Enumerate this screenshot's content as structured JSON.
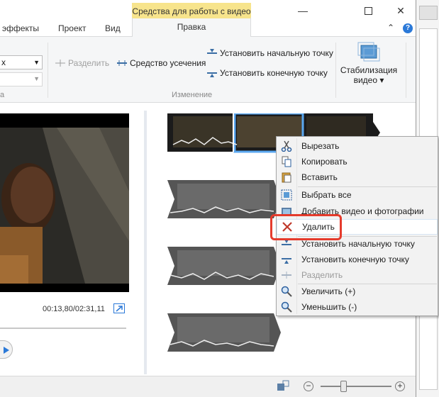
{
  "context_tab_header": "Средства для работы с видео",
  "window_controls": {
    "minimize": "—",
    "maximize": "☐",
    "close": "✕"
  },
  "tabs": {
    "effects": "эффекты",
    "project": "Проект",
    "view": "Вид",
    "edit": "Правка"
  },
  "help_icons": {
    "collapse": "⌃",
    "help": "?"
  },
  "ribbon": {
    "combo_value": "х",
    "split_label": "Разделить",
    "trim_tool_label": "Средство усечения",
    "set_start_label": "Установить начальную точку",
    "set_end_label": "Установить конечную точку",
    "stabilization_label_1": "Стабилизация",
    "stabilization_label_2": "видео ▾",
    "group_left_label": "а",
    "group_edit_label": "Изменение"
  },
  "preview": {
    "time": "00:13,80/02:31,11"
  },
  "context_menu": {
    "items": [
      {
        "label": "Вырезать",
        "icon": "scissors-icon"
      },
      {
        "label": "Копировать",
        "icon": "copy-icon"
      },
      {
        "label": "Вставить",
        "icon": "paste-icon"
      },
      {
        "label": "Выбрать все",
        "icon": "select-all-icon"
      },
      {
        "label": "Добавить видео и фотографии",
        "icon": "add-media-icon"
      },
      {
        "label": "Удалить",
        "icon": "delete-icon"
      },
      {
        "label": "Установить начальную точку",
        "icon": "set-start-icon"
      },
      {
        "label": "Установить конечную точку",
        "icon": "set-end-icon"
      },
      {
        "label": "Разделить",
        "icon": "split-icon"
      },
      {
        "label": "Увеличить (+)",
        "icon": "zoom-in-icon"
      },
      {
        "label": "Уменьшить (-)",
        "icon": "zoom-out-icon"
      }
    ]
  },
  "status": {
    "zoom_minus": "−",
    "zoom_plus": "+"
  },
  "colors": {
    "context_tab": "#f7e48c",
    "highlight": "#e53b2c",
    "accent_blue": "#2b79d8"
  }
}
